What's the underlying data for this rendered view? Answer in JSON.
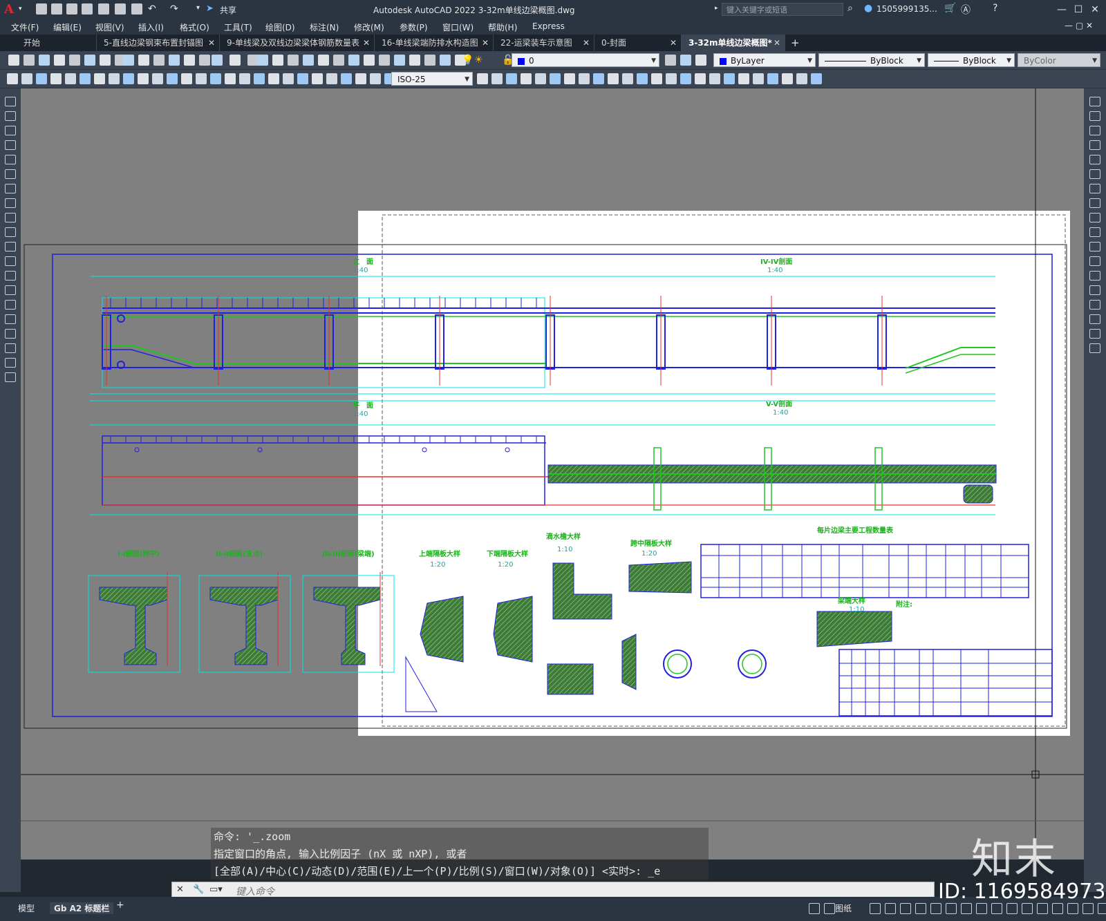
{
  "app": {
    "title": "Autodesk AutoCAD 2022    3-32m单线边梁概图.dwg",
    "share_label": "共享",
    "search_placeholder": "键入关键字或短语",
    "user": "1505999135...",
    "logo_letter": "A"
  },
  "menu": [
    "文件(F)",
    "编辑(E)",
    "视图(V)",
    "插入(I)",
    "格式(O)",
    "工具(T)",
    "绘图(D)",
    "标注(N)",
    "修改(M)",
    "参数(P)",
    "窗口(W)",
    "帮助(H)",
    "Express"
  ],
  "tabs": [
    {
      "label": "开始",
      "active": false,
      "closable": false
    },
    {
      "label": "5-直线边梁钢束布置封锚图",
      "active": false,
      "closable": true
    },
    {
      "label": "9-单线梁及双线边梁梁体钢筋数量表",
      "active": false,
      "closable": true
    },
    {
      "label": "16-单线梁端防排水构造图",
      "active": false,
      "closable": true
    },
    {
      "label": "22-运梁装车示意图",
      "active": false,
      "closable": true
    },
    {
      "label": "0-封面",
      "active": false,
      "closable": true
    },
    {
      "label": "3-32m单线边梁概图*",
      "active": true,
      "closable": true
    }
  ],
  "layer": {
    "name": "0",
    "color": "#0000ff"
  },
  "properties": {
    "color": "ByLayer",
    "linetype": "ByBlock",
    "lineweight": "ByBlock",
    "plotstyle": "ByColor"
  },
  "dimstyle": "ISO-25",
  "drawing": {
    "labels": [
      {
        "id": "elev",
        "text": "立　面"
      },
      {
        "id": "elev_scale",
        "text": "1:40"
      },
      {
        "id": "sec4",
        "text": "IV-IV剖面"
      },
      {
        "id": "sec4_scale",
        "text": "1:40"
      },
      {
        "id": "plan",
        "text": "平　面"
      },
      {
        "id": "plan_scale",
        "text": "1:40"
      },
      {
        "id": "sec5",
        "text": "V-V剖面"
      },
      {
        "id": "sec5_scale",
        "text": "1:40"
      },
      {
        "id": "sec1",
        "text": "I-I剖面(跨中)"
      },
      {
        "id": "sec2",
        "text": "II-II剖面(支点)"
      },
      {
        "id": "sec3",
        "text": "III-III剖面(梁端)"
      },
      {
        "id": "topslab",
        "text": "上端隔板大样"
      },
      {
        "id": "topslab_scale",
        "text": "1:20"
      },
      {
        "id": "botslab",
        "text": "下端隔板大样"
      },
      {
        "id": "botslab_scale",
        "text": "1:20"
      },
      {
        "id": "drip",
        "text": "滴水檐大样"
      },
      {
        "id": "drip_scale",
        "text": "1:10"
      },
      {
        "id": "midslab",
        "text": "跨中隔板大样"
      },
      {
        "id": "midslab_scale",
        "text": "1:20"
      },
      {
        "id": "qty_title",
        "text": "每片边梁主要工程数量表"
      },
      {
        "id": "notes_title",
        "text": "附注:"
      },
      {
        "id": "detail_a",
        "text": "梁端大样"
      },
      {
        "id": "detail_a_scale",
        "text": "1:10"
      }
    ]
  },
  "command": {
    "history": [
      "命令: '_.zoom",
      "指定窗口的角点, 输入比例因子 (nX 或 nXP), 或者",
      "[全部(A)/中心(C)/动态(D)/范围(E)/上一个(P)/比例(S)/窗口(W)/对象(O)] <实时>: _e"
    ],
    "placeholder": "键入命令"
  },
  "layout_tabs": [
    "模型",
    "Gb A2 标题栏"
  ],
  "status": {
    "paper_label": "图纸"
  },
  "watermark": {
    "logo": "知末",
    "id": "ID: 1169584973"
  }
}
